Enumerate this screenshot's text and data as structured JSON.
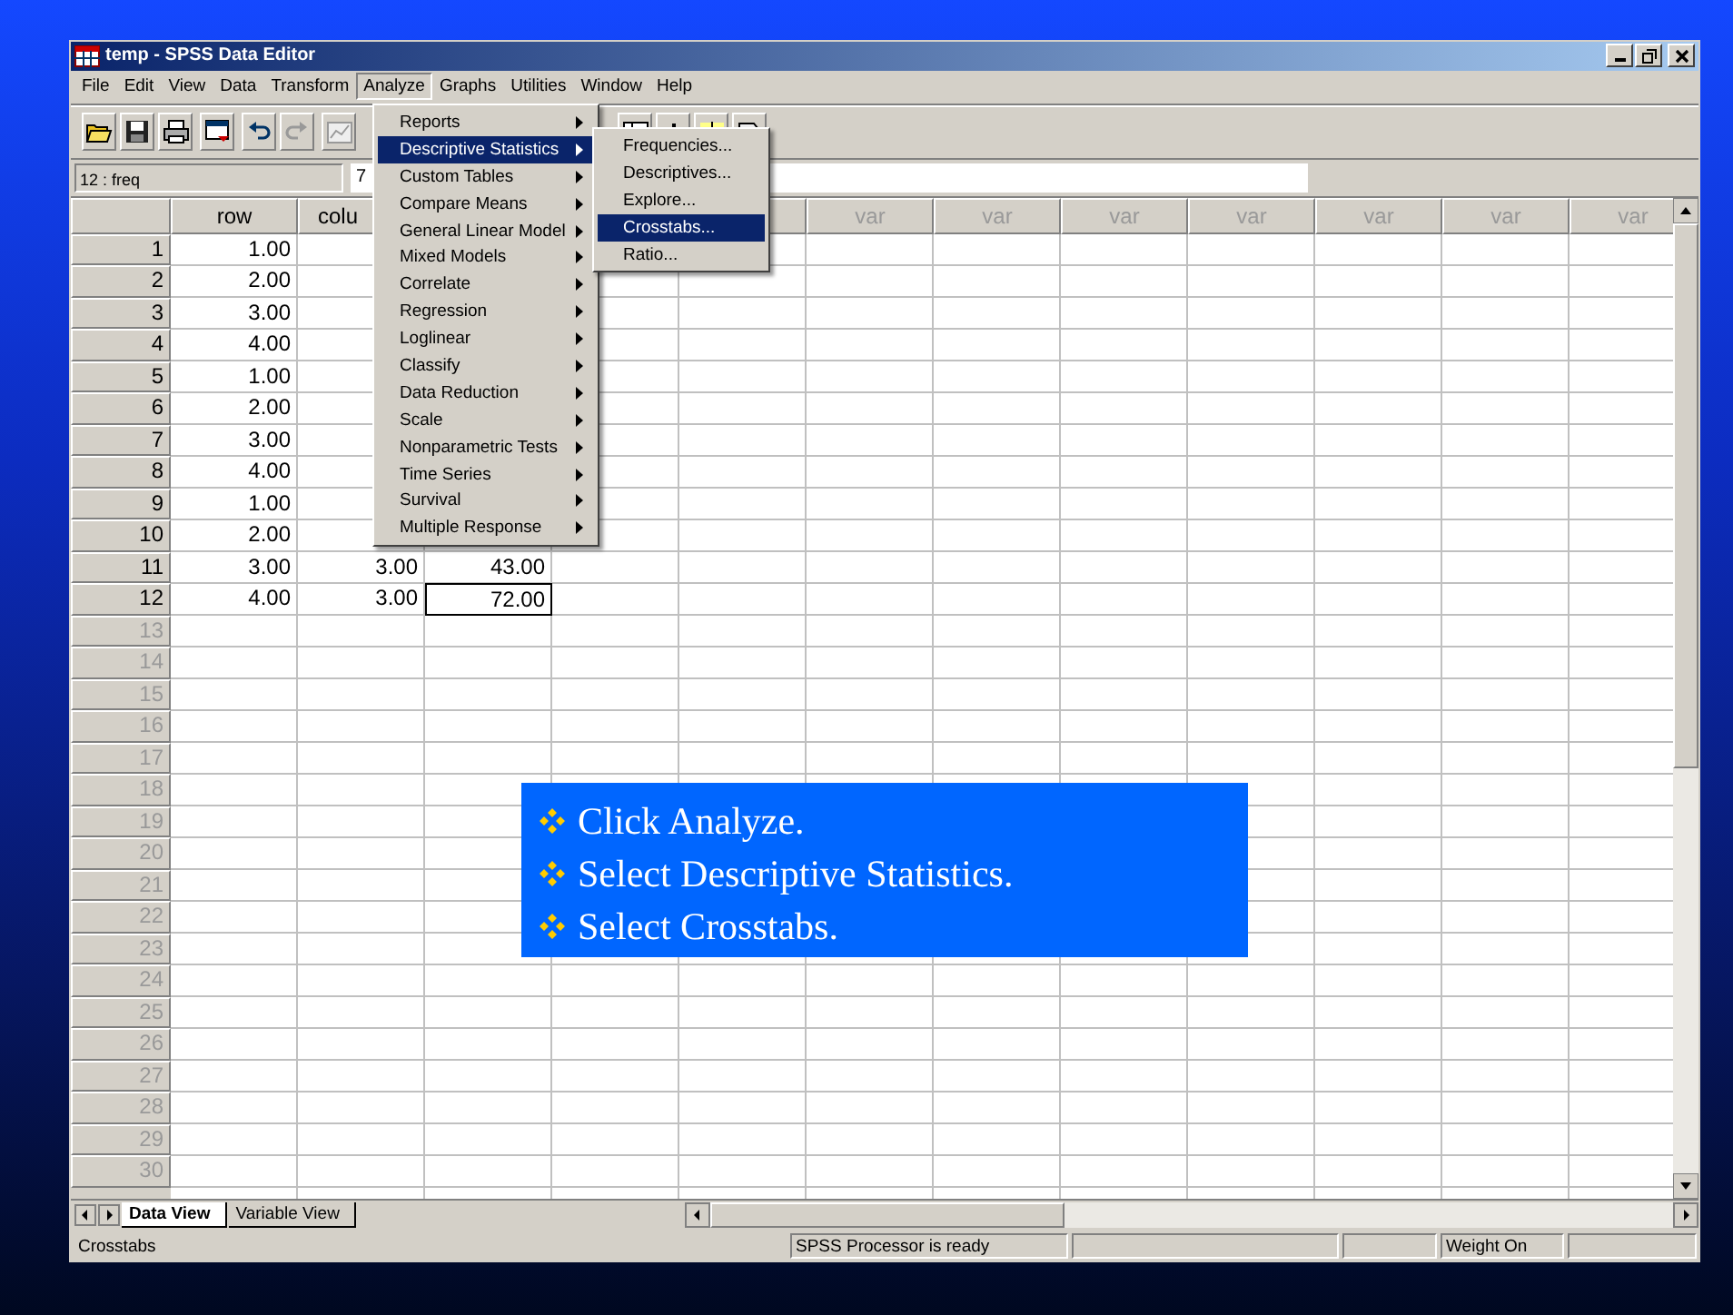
{
  "window": {
    "title": "temp - SPSS Data Editor"
  },
  "menu_bar": [
    {
      "label": "File",
      "selected": false
    },
    {
      "label": "Edit",
      "selected": false
    },
    {
      "label": "View",
      "selected": false
    },
    {
      "label": "Data",
      "selected": false
    },
    {
      "label": "Transform",
      "selected": false
    },
    {
      "label": "Analyze",
      "selected": true
    },
    {
      "label": "Graphs",
      "selected": false
    },
    {
      "label": "Utilities",
      "selected": false
    },
    {
      "label": "Window",
      "selected": false
    },
    {
      "label": "Help",
      "selected": false
    }
  ],
  "cell_editor": {
    "cell_ref": "12 : freq",
    "value": "7"
  },
  "grid": {
    "columns": [
      {
        "label": "row",
        "clipped": false
      },
      {
        "label": "colu",
        "clipped": true
      },
      {},
      {},
      {},
      {
        "label": "var",
        "clipped": false
      },
      {
        "label": "var",
        "clipped": false
      },
      {
        "label": "var",
        "clipped": false
      },
      {
        "label": "var",
        "clipped": false
      },
      {
        "label": "var",
        "clipped": false
      },
      {
        "label": "var",
        "clipped": false
      },
      {
        "label": "var",
        "clipped": false
      }
    ],
    "rows": [
      {
        "number": "1",
        "has_data": true,
        "cells": [
          {
            "value": "1.00",
            "selected": false
          }
        ]
      },
      {
        "number": "2",
        "has_data": true,
        "cells": [
          {
            "value": "2.00",
            "selected": false
          }
        ]
      },
      {
        "number": "3",
        "has_data": true,
        "cells": [
          {
            "value": "3.00",
            "selected": false
          }
        ]
      },
      {
        "number": "4",
        "has_data": true,
        "cells": [
          {
            "value": "4.00",
            "selected": false
          }
        ]
      },
      {
        "number": "5",
        "has_data": true,
        "cells": [
          {
            "value": "1.00",
            "selected": false
          }
        ]
      },
      {
        "number": "6",
        "has_data": true,
        "cells": [
          {
            "value": "2.00",
            "selected": false
          }
        ]
      },
      {
        "number": "7",
        "has_data": true,
        "cells": [
          {
            "value": "3.00",
            "selected": false
          }
        ]
      },
      {
        "number": "8",
        "has_data": true,
        "cells": [
          {
            "value": "4.00",
            "selected": false
          }
        ]
      },
      {
        "number": "9",
        "has_data": true,
        "cells": [
          {
            "value": "1.00",
            "selected": false
          }
        ]
      },
      {
        "number": "10",
        "has_data": true,
        "cells": [
          {
            "value": "2.00",
            "selected": false
          }
        ]
      },
      {
        "number": "11",
        "has_data": true,
        "cells": [
          {
            "value": "3.00",
            "selected": false
          },
          {
            "value": "3.00",
            "selected": false
          },
          {
            "value": "43.00",
            "selected": false
          }
        ]
      },
      {
        "number": "12",
        "has_data": true,
        "cells": [
          {
            "value": "4.00",
            "selected": false
          },
          {
            "value": "3.00",
            "selected": false
          },
          {
            "value": "72.00",
            "selected": true
          }
        ]
      },
      {
        "number": "13",
        "has_data": false
      },
      {
        "number": "14",
        "has_data": false
      },
      {
        "number": "15",
        "has_data": false
      },
      {
        "number": "16",
        "has_data": false
      },
      {
        "number": "17",
        "has_data": false
      },
      {
        "number": "18",
        "has_data": false
      },
      {
        "number": "19",
        "has_data": false
      },
      {
        "number": "20",
        "has_data": false
      },
      {
        "number": "21",
        "has_data": false
      },
      {
        "number": "22",
        "has_data": false
      },
      {
        "number": "23",
        "has_data": false
      },
      {
        "number": "24",
        "has_data": false
      },
      {
        "number": "25",
        "has_data": false
      },
      {
        "number": "26",
        "has_data": false
      },
      {
        "number": "27",
        "has_data": false
      },
      {
        "number": "28",
        "has_data": false
      },
      {
        "number": "29",
        "has_data": false
      },
      {
        "number": "30",
        "has_data": false
      }
    ]
  },
  "analyze_menu": [
    {
      "label": "Reports",
      "selected": false
    },
    {
      "label": "Descriptive Statistics",
      "selected": true
    },
    {
      "label": "Custom Tables",
      "selected": false
    },
    {
      "label": "Compare Means",
      "selected": false
    },
    {
      "label": "General Linear Model",
      "selected": false
    },
    {
      "label": "Mixed Models",
      "selected": false
    },
    {
      "label": "Correlate",
      "selected": false
    },
    {
      "label": "Regression",
      "selected": false
    },
    {
      "label": "Loglinear",
      "selected": false
    },
    {
      "label": "Classify",
      "selected": false
    },
    {
      "label": "Data Reduction",
      "selected": false
    },
    {
      "label": "Scale",
      "selected": false
    },
    {
      "label": "Nonparametric Tests",
      "selected": false
    },
    {
      "label": "Time Series",
      "selected": false
    },
    {
      "label": "Survival",
      "selected": false
    },
    {
      "label": "Multiple Response",
      "selected": false
    }
  ],
  "submenu": [
    {
      "label": "Frequencies...",
      "selected": false
    },
    {
      "label": "Descriptives...",
      "selected": false
    },
    {
      "label": "Explore...",
      "selected": false
    },
    {
      "label": "Crosstabs...",
      "selected": true
    },
    {
      "label": "Ratio...",
      "selected": false
    }
  ],
  "sheet_tabs": [
    {
      "label": "Data View",
      "selected": true
    },
    {
      "label": "Variable View",
      "selected": false
    }
  ],
  "status_bar": {
    "message": "Crosstabs",
    "processor": "SPSS Processor  is ready",
    "weight": "Weight On"
  },
  "callout": [
    "Click Analyze.",
    "Select Descriptive Statistics.",
    "Select Crosstabs."
  ]
}
